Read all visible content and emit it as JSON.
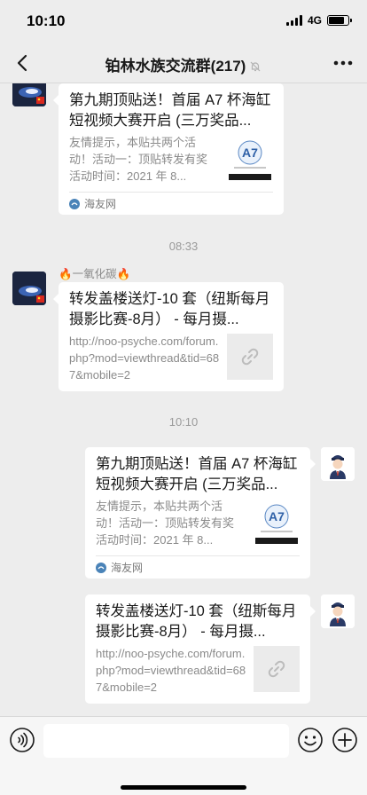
{
  "status": {
    "time": "10:10",
    "network": "4G",
    "battery_percent": 80
  },
  "nav": {
    "title": "铂林水族交流群(217)",
    "back_icon": "chevron-left-icon",
    "mute_icon": "bell-muted-icon",
    "more_icon": "ellipsis-icon"
  },
  "messages": [
    {
      "type": "link_card",
      "side": "left",
      "title": "第九期顶贴送！首届 A7 杯海缸短视频大赛开启 (三万奖品...",
      "description": "友情提示，本贴共两个活动！活动一：顶贴转发有奖活动时间：2021 年 8...",
      "source": "海友网",
      "thumbnail": "poster-thumbnail"
    },
    {
      "type": "timestamp",
      "text": "08:33"
    },
    {
      "type": "link_card",
      "side": "left",
      "sender": "🔥一氧化碳🔥",
      "title": "转发盖楼送灯-10 套（纽斯每月摄影比赛-8月） - 每月摄...",
      "description": "http://noo-psyche.com/forum.php?mod=viewthread&tid=687&mobile=2",
      "thumbnail": "link-icon"
    },
    {
      "type": "timestamp",
      "text": "10:10"
    },
    {
      "type": "link_card",
      "side": "right",
      "title": "第九期顶贴送！首届 A7 杯海缸短视频大赛开启 (三万奖品...",
      "description": "友情提示，本贴共两个活动！活动一：顶贴转发有奖活动时间：2021 年 8...",
      "source": "海友网",
      "thumbnail": "poster-thumbnail"
    },
    {
      "type": "link_card",
      "side": "right",
      "title": "转发盖楼送灯-10 套（纽斯每月摄影比赛-8月） - 每月摄...",
      "description": "http://noo-psyche.com/forum.php?mod=viewthread&tid=687&mobile=2",
      "thumbnail": "link-icon"
    }
  ],
  "input_bar": {
    "voice_icon": "voice-icon",
    "text_value": "",
    "emoji_icon": "emoji-icon",
    "plus_icon": "plus-icon"
  }
}
